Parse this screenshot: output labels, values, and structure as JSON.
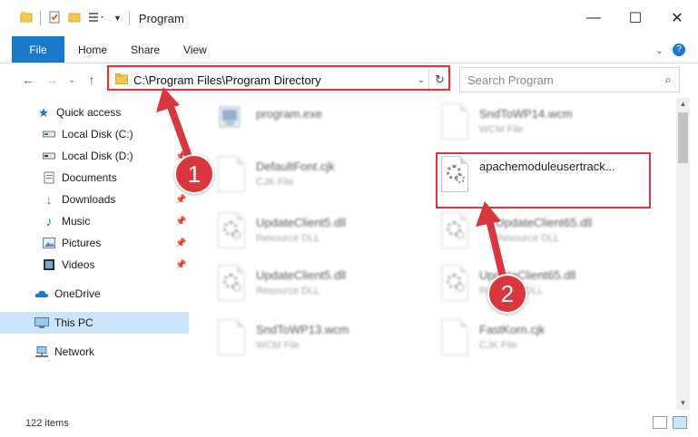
{
  "window": {
    "title": "Program",
    "minimize_icon": "minimize-icon",
    "maximize_icon": "maximize-icon",
    "close_icon": "close-icon"
  },
  "ribbon": {
    "tabs": [
      {
        "label": "File"
      },
      {
        "label": "Home"
      },
      {
        "label": "Share"
      },
      {
        "label": "View"
      }
    ]
  },
  "nav": {
    "address": "C:\\Program Files\\Program Directory",
    "search_placeholder": "Search Program"
  },
  "sidebar": {
    "items": [
      {
        "label": "Quick access",
        "icon": "star-icon"
      },
      {
        "label": "Local Disk (C:)",
        "icon": "drive-icon"
      },
      {
        "label": "Local Disk (D:)",
        "icon": "drive-icon"
      },
      {
        "label": "Documents",
        "icon": "documents-icon"
      },
      {
        "label": "Downloads",
        "icon": "download-icon"
      },
      {
        "label": "Music",
        "icon": "music-icon"
      },
      {
        "label": "Pictures",
        "icon": "pictures-icon"
      },
      {
        "label": "Videos",
        "icon": "videos-icon"
      },
      {
        "label": "OneDrive",
        "icon": "cloud-icon"
      },
      {
        "label": "This PC",
        "icon": "computer-icon"
      },
      {
        "label": "Network",
        "icon": "network-icon"
      }
    ]
  },
  "files": [
    {
      "name": "program.exe",
      "type": ""
    },
    {
      "name": "SndToWP14.wcm",
      "type": "WCM File"
    },
    {
      "name": "DefaultFont.cjk",
      "type": "CJK File"
    },
    {
      "name": "apachemoduleusertrack...",
      "type": ""
    },
    {
      "name": "UpdateClient5.dll",
      "type": "Resource DLL"
    },
    {
      "name": "UpdateClient65.dll",
      "type": "Resource DLL"
    },
    {
      "name": "UpdateClient5.dll",
      "type": "Resource DLL"
    },
    {
      "name": "UpdateClient65.dll",
      "type": "Resource DLL"
    },
    {
      "name": "SndToWP13.wcm",
      "type": "WCM File"
    },
    {
      "name": "FastKorn.cjk",
      "type": "CJK File"
    }
  ],
  "status": {
    "item_count": "122 items"
  },
  "annotations": {
    "step1": "1",
    "step2": "2",
    "color": "#d9363e"
  },
  "colors": {
    "accent": "#1979ca",
    "selection": "#cce4f7"
  }
}
